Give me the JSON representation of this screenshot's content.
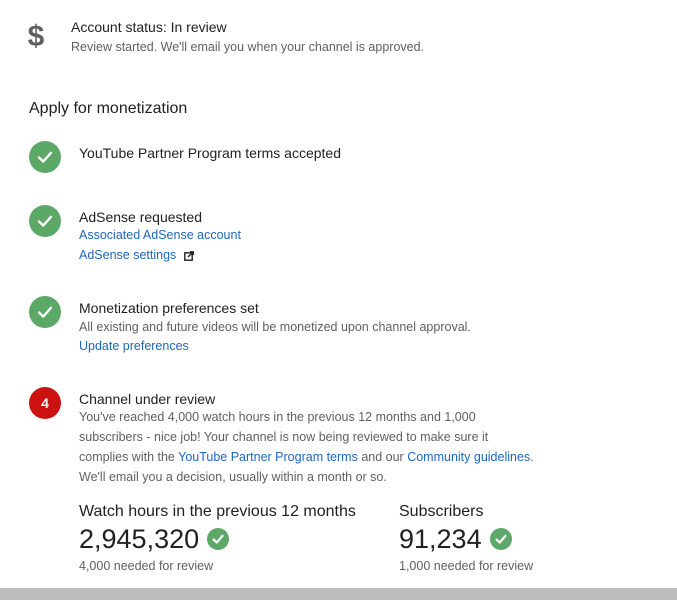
{
  "account_status": {
    "icon": "dollar-icon",
    "title": "Account status: In review",
    "subtitle": "Review started. We'll email you when your channel is approved."
  },
  "monetization": {
    "heading": "Apply for monetization",
    "steps": [
      {
        "status": "done",
        "title": "YouTube Partner Program terms accepted"
      },
      {
        "status": "done",
        "title": "AdSense requested",
        "links": [
          "Associated AdSense account",
          "AdSense settings"
        ]
      },
      {
        "status": "done",
        "title": "Monetization preferences set",
        "description": "All existing and future videos will be monetized upon channel approval.",
        "link": "Update preferences"
      },
      {
        "status": "in-progress",
        "number": "4",
        "title": "Channel under review",
        "description": {
          "line1": "You've reached 4,000 watch hours in the previous 12 months and 1,000",
          "line2": "subscribers - nice job! Your channel is now being reviewed to make sure it",
          "line3_prefix": "complies with the ",
          "line3_link1": "YouTube Partner Program terms",
          "line3_middle": " and our ",
          "line3_link2": "Community guidelines",
          "line3_suffix": ".",
          "line4": "We'll email you a decision, usually within a month or so."
        }
      }
    ]
  },
  "stats": [
    {
      "label": "Watch hours in the previous 12 months",
      "value": "2,945,320",
      "note": "4,000 needed for review"
    },
    {
      "label": "Subscribers",
      "value": "91,234",
      "note": "1,000 needed for review"
    }
  ],
  "colors": {
    "success": "#5ba867",
    "alert": "#cc1111",
    "link": "#2266bb",
    "secondary_text": "#606060"
  }
}
